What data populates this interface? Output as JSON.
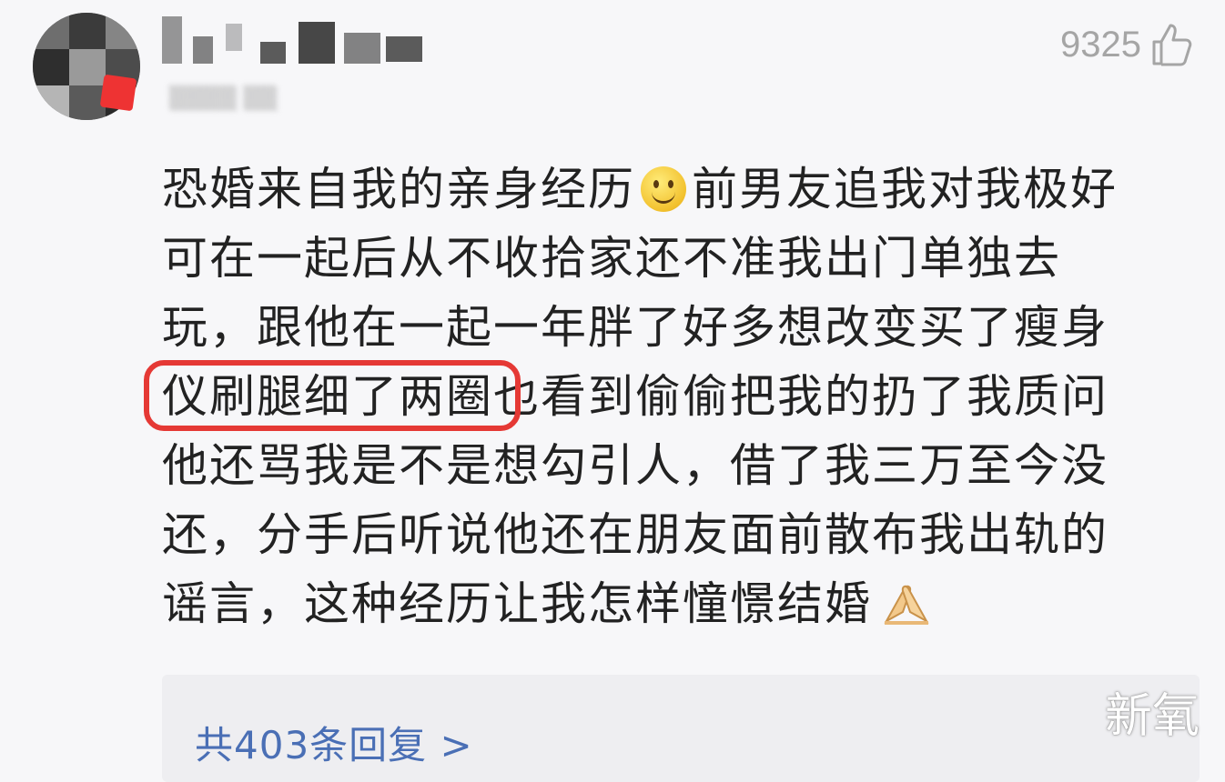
{
  "comment": {
    "likes": "9325",
    "lines": [
      "恐婚来自我的亲身经历",
      "前男友追我对我极好",
      "可在一起后从不收拾家还不准我出门单独去",
      "玩，跟他在一起一年胖了好多想改变买了瘦身",
      "仪刷腿细了两圈",
      "也看到偷偷把我的扔了我质问",
      "他还骂我是不是想勾引人，借了我三万至今没",
      "还，分手后听说他还在朋友面前散布我出轨的",
      "谣言，这种经历让我怎样憧憬结婚"
    ],
    "emojis": [
      "smiling-face-icon",
      "praying-hands-icon"
    ]
  },
  "replies": {
    "label": "共403条回复 >"
  },
  "watermark": "新氧",
  "colors": {
    "highlight": "#e53935",
    "link": "#4a6fb5",
    "text": "#222222"
  }
}
